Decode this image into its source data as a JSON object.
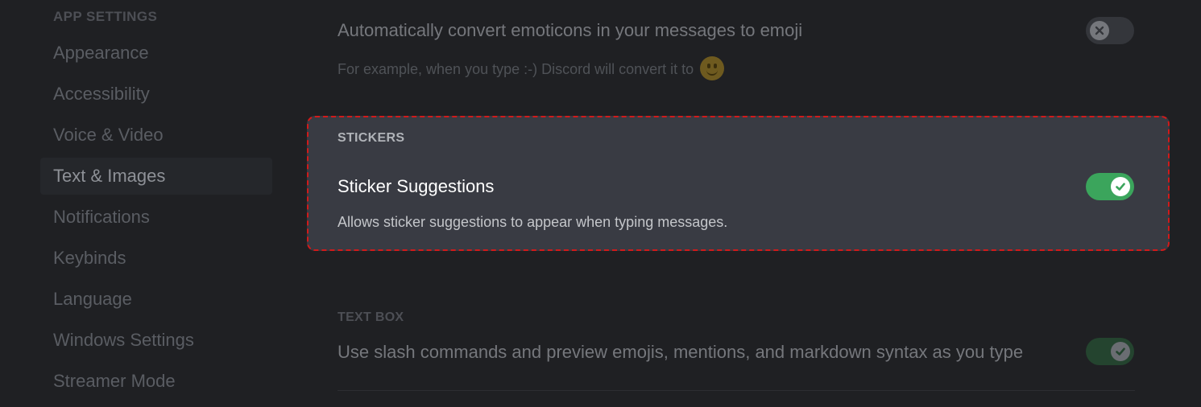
{
  "sidebar": {
    "header": "APP SETTINGS",
    "items": [
      {
        "label": "Appearance"
      },
      {
        "label": "Accessibility"
      },
      {
        "label": "Voice & Video"
      },
      {
        "label": "Text & Images"
      },
      {
        "label": "Notifications"
      },
      {
        "label": "Keybinds"
      },
      {
        "label": "Language"
      },
      {
        "label": "Windows Settings"
      },
      {
        "label": "Streamer Mode"
      }
    ],
    "selected": "Text & Images"
  },
  "main": {
    "emoticons": {
      "title": "Automatically convert emoticons in your messages to emoji",
      "description": "For example, when you type :-) Discord will convert it to",
      "emoji_icon": "slightly-smiling-face-icon",
      "enabled": false
    },
    "stickers": {
      "section_label": "STICKERS",
      "title": "Sticker Suggestions",
      "description": "Allows sticker suggestions to appear when typing messages.",
      "enabled": true
    },
    "text_box": {
      "section_label": "TEXT BOX",
      "title": "Use slash commands and preview emojis, mentions, and markdown syntax as you type",
      "enabled": true
    }
  },
  "colors": {
    "toggle_on": "#3ba55c",
    "toggle_off": "#34363b",
    "highlight_border": "#d11a1a",
    "highlight_bg": "#393b43"
  }
}
